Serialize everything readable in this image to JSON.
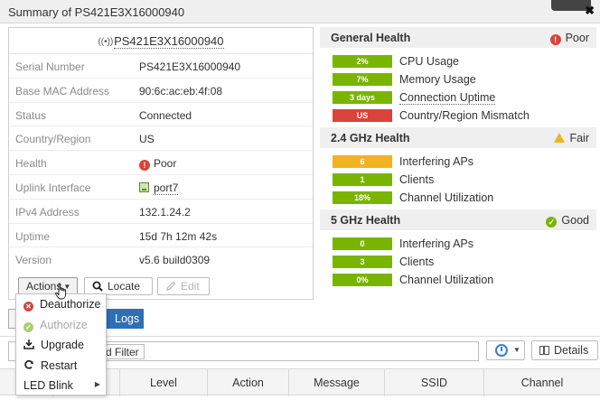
{
  "window": {
    "title": "Summary of PS421E3X16000940",
    "close_glyph": "✖"
  },
  "device": {
    "name": "PS421E3X16000940",
    "rows": [
      {
        "label": "Serial Number",
        "value": "PS421E3X16000940"
      },
      {
        "label": "Base MAC Address",
        "value": "90:6c:ac:eb:4f:08"
      },
      {
        "label": "Status",
        "value": "Connected"
      },
      {
        "label": "Country/Region",
        "value": "US"
      },
      {
        "label": "Health",
        "value": "Poor"
      },
      {
        "label": "Uplink Interface",
        "value": "port7"
      },
      {
        "label": "IPv4 Address",
        "value": "132.1.24.2"
      },
      {
        "label": "Uptime",
        "value": "15d 7h 12m 42s"
      },
      {
        "label": "Version",
        "value": "v5.6 build0309"
      }
    ]
  },
  "toolbar": {
    "actions": "Actions",
    "locate": "Locate",
    "edit": "Edit"
  },
  "actions_menu": [
    {
      "label": "Deauthorize",
      "icon": "x-circle-icon",
      "enabled": true
    },
    {
      "label": "Authorize",
      "icon": "check-circle-icon",
      "enabled": false
    },
    {
      "label": "Upgrade",
      "icon": "upgrade-icon",
      "enabled": true
    },
    {
      "label": "Restart",
      "icon": "refresh-icon",
      "enabled": true
    },
    {
      "label": "LED Blink",
      "icon": "",
      "enabled": true,
      "submenu": true
    }
  ],
  "health": {
    "general": {
      "title": "General Health",
      "status": "Poor",
      "items": [
        {
          "bar": "2%",
          "label": "CPU Usage",
          "color": "#79b500"
        },
        {
          "bar": "7%",
          "label": "Memory Usage",
          "color": "#79b500"
        },
        {
          "bar": "3 days",
          "label": "Connection Uptime",
          "color": "#79b500",
          "dotted": true
        },
        {
          "bar": "US",
          "label": "Country/Region Mismatch",
          "color": "#d9433b"
        }
      ]
    },
    "ghz24": {
      "title": "2.4 GHz Health",
      "status": "Fair",
      "items": [
        {
          "bar": "6",
          "label": "Interfering APs",
          "color": "#f0b323"
        },
        {
          "bar": "1",
          "label": "Clients",
          "color": "#79b500"
        },
        {
          "bar": "18%",
          "label": "Channel Utilization",
          "color": "#79b500"
        }
      ]
    },
    "ghz5": {
      "title": "5 GHz Health",
      "status": "Good",
      "items": [
        {
          "bar": "0",
          "label": "Interfering APs",
          "color": "#79b500"
        },
        {
          "bar": "3",
          "label": "Clients",
          "color": "#79b500"
        },
        {
          "bar": "0%",
          "label": "Channel Utilization",
          "color": "#79b500"
        }
      ]
    }
  },
  "background": {
    "logs_tab": "Logs",
    "filter_button": "d Filter",
    "details_button": "Details",
    "columns": [
      "Level",
      "Action",
      "Message",
      "SSID",
      "Channel"
    ]
  },
  "colors": {
    "good": "#79b500",
    "poor": "#d9433b",
    "fair": "#f0b323",
    "accent": "#2f6fb5"
  }
}
